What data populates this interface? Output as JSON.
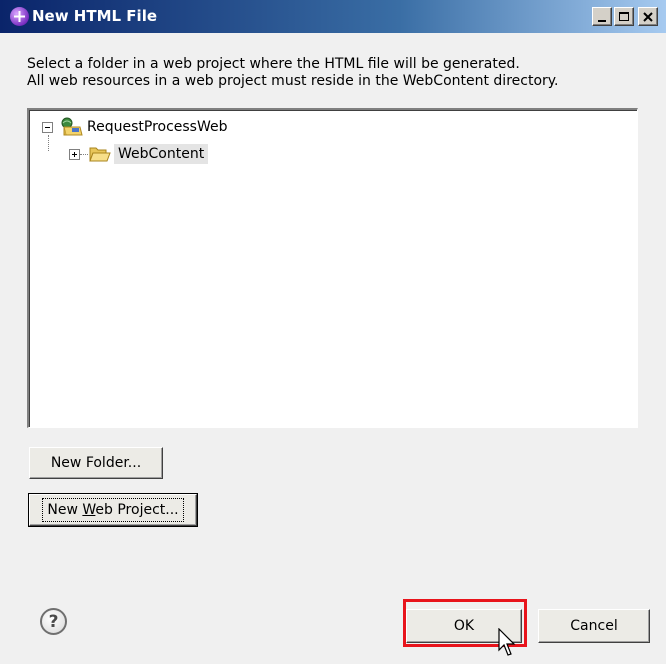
{
  "window": {
    "title": "New HTML File"
  },
  "description": {
    "line1": "Select a folder in a web project where the HTML file will be generated.",
    "line2": "All web resources in a web project must reside in the WebContent directory."
  },
  "tree": {
    "items": [
      {
        "label": "RequestProcessWeb",
        "expanded": true,
        "selected": false
      },
      {
        "label": "WebContent",
        "expanded": false,
        "selected": true
      }
    ]
  },
  "buttons": {
    "new_folder": "New Folder...",
    "new_web_project_pre": "New ",
    "new_web_project_mnemonic": "W",
    "new_web_project_post": "eb Project...",
    "ok": "OK",
    "cancel": "Cancel",
    "help": "?"
  },
  "colors": {
    "title_bar": "#0a246a",
    "highlight_box": "#e8141c",
    "selected_item": "#e4e4e4"
  }
}
